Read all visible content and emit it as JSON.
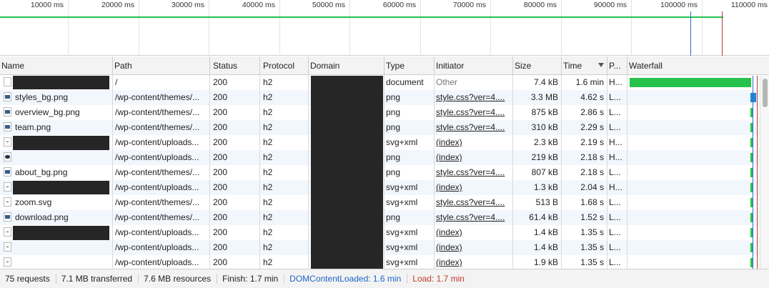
{
  "overview": {
    "ticks": [
      "10000 ms",
      "20000 ms",
      "30000 ms",
      "40000 ms",
      "50000 ms",
      "60000 ms",
      "70000 ms",
      "80000 ms",
      "90000 ms",
      "100000 ms",
      "110000 ms"
    ]
  },
  "columns": {
    "name": "Name",
    "path": "Path",
    "status": "Status",
    "protocol": "Protocol",
    "domain": "Domain",
    "type": "Type",
    "initiator": "Initiator",
    "size": "Size",
    "time": "Time",
    "priority": "P...",
    "waterfall": "Waterfall"
  },
  "rows": [
    {
      "name": "",
      "path": "/",
      "status": "200",
      "protocol": "h2",
      "type": "document",
      "initiator": "Other",
      "size": "7.4 kB",
      "time": "1.6 min",
      "priority": "H...",
      "icon": "document-icon"
    },
    {
      "name": "styles_bg.png",
      "path": "/wp-content/themes/...",
      "status": "200",
      "protocol": "h2",
      "type": "png",
      "initiator": "style.css?ver=4....",
      "size": "3.3 MB",
      "time": "4.62 s",
      "priority": "L...",
      "icon": "image-icon"
    },
    {
      "name": "overview_bg.png",
      "path": "/wp-content/themes/...",
      "status": "200",
      "protocol": "h2",
      "type": "png",
      "initiator": "style.css?ver=4....",
      "size": "875 kB",
      "time": "2.86 s",
      "priority": "L...",
      "icon": "image-icon"
    },
    {
      "name": "team.png",
      "path": "/wp-content/themes/...",
      "status": "200",
      "protocol": "h2",
      "type": "png",
      "initiator": "style.css?ver=4....",
      "size": "310 kB",
      "time": "2.29 s",
      "priority": "L...",
      "icon": "image-icon"
    },
    {
      "name": "",
      "path": "/wp-content/uploads...",
      "status": "200",
      "protocol": "h2",
      "type": "svg+xml",
      "initiator": "(index)",
      "size": "2.3 kB",
      "time": "2.19 s",
      "priority": "H...",
      "icon": "svg-icon"
    },
    {
      "name": "",
      "path": "/wp-content/uploads...",
      "status": "200",
      "protocol": "h2",
      "type": "png",
      "initiator": "(index)",
      "size": "219 kB",
      "time": "2.18 s",
      "priority": "H...",
      "icon": "image-icon"
    },
    {
      "name": "about_bg.png",
      "path": "/wp-content/themes/...",
      "status": "200",
      "protocol": "h2",
      "type": "png",
      "initiator": "style.css?ver=4....",
      "size": "807 kB",
      "time": "2.18 s",
      "priority": "L...",
      "icon": "image-icon"
    },
    {
      "name": "",
      "path": "/wp-content/uploads...",
      "status": "200",
      "protocol": "h2",
      "type": "svg+xml",
      "initiator": "(index)",
      "size": "1.3 kB",
      "time": "2.04 s",
      "priority": "H...",
      "icon": "svg-icon"
    },
    {
      "name": "zoom.svg",
      "path": "/wp-content/themes/...",
      "status": "200",
      "protocol": "h2",
      "type": "svg+xml",
      "initiator": "style.css?ver=4....",
      "size": "513 B",
      "time": "1.68 s",
      "priority": "L...",
      "icon": "svg-icon"
    },
    {
      "name": "download.png",
      "path": "/wp-content/themes/...",
      "status": "200",
      "protocol": "h2",
      "type": "png",
      "initiator": "style.css?ver=4....",
      "size": "61.4 kB",
      "time": "1.52 s",
      "priority": "L...",
      "icon": "image-icon"
    },
    {
      "name": "",
      "path": "/wp-content/uploads...",
      "status": "200",
      "protocol": "h2",
      "type": "svg+xml",
      "initiator": "(index)",
      "size": "1.4 kB",
      "time": "1.35 s",
      "priority": "L...",
      "icon": "svg-icon"
    },
    {
      "name": "",
      "path": "/wp-content/uploads...",
      "status": "200",
      "protocol": "h2",
      "type": "svg+xml",
      "initiator": "(index)",
      "size": "1.4 kB",
      "time": "1.35 s",
      "priority": "L...",
      "icon": "svg-icon"
    },
    {
      "name": "",
      "path": "/wp-content/uploads...",
      "status": "200",
      "protocol": "h2",
      "type": "svg+xml",
      "initiator": "(index)",
      "size": "1.9 kB",
      "time": "1.35 s",
      "priority": "L...",
      "icon": "svg-icon"
    }
  ],
  "footer": {
    "requests": "75 requests",
    "transferred": "7.1 MB transferred",
    "resources": "7.6 MB resources",
    "finish": "Finish: 1.7 min",
    "dom_content_loaded": "DOMContentLoaded: 1.6 min",
    "load": "Load: 1.7 min"
  },
  "colors": {
    "waterfall_green": "#27c24c",
    "waterfall_blue": "#1e88d6",
    "dcl_line": "#2a6ccf",
    "load_line": "#b33a3a"
  }
}
